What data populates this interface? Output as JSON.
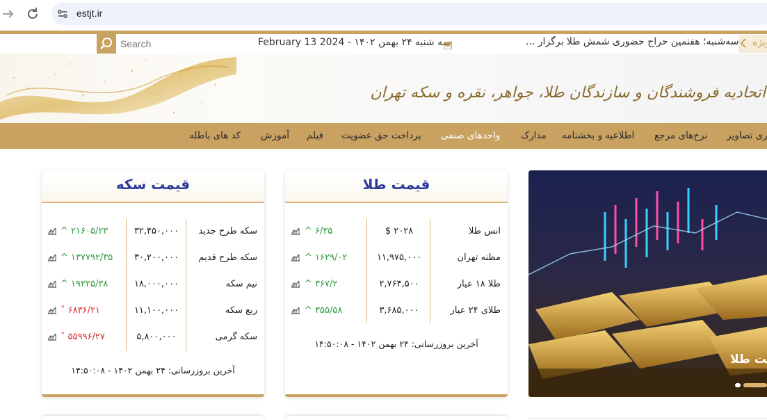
{
  "browser": {
    "back_icon": "arrow-right-icon",
    "reload_icon": "reload-icon",
    "url": "estjt.ir"
  },
  "topbar": {
    "search_placeholder": "Search",
    "date": "سه شنبه ۲۴ بهمن ۱۴۰۲ - February 13 2024",
    "news": "سه‌شنبه؛ هفتمین حراج حضوری شمش طلا برگزار ...",
    "special_label": "ویژه"
  },
  "header": {
    "logo_text": "اتحادیه فروشندگان و سازندگان طلا، جواهر، نقره و سکه تهران"
  },
  "menu": {
    "items": [
      {
        "label": "گالری تصاویر",
        "active": false
      },
      {
        "label": "نرخ‌های مرجع",
        "active": false
      },
      {
        "label": "اطلاعیه و بخشنامه",
        "active": false
      },
      {
        "label": "مدارک",
        "active": false
      },
      {
        "label": "واحدهای صنفی",
        "active": true
      },
      {
        "label": "پرداخت حق عضویت",
        "active": false
      },
      {
        "label": "فیلم",
        "active": false
      },
      {
        "label": "آموزش",
        "active": false
      },
      {
        "label": "کد های باطله",
        "active": false
      }
    ]
  },
  "gold_card": {
    "title": "قیمت طلا",
    "rows": [
      {
        "name": "انس طلا",
        "value": "۲۰۲۸ $",
        "change": "۶/۳۵",
        "direction": "up"
      },
      {
        "name": "مظنه تهران",
        "value": "۱۱,۹۷۵,۰۰۰",
        "change": "۱۶۲۹/۰۲",
        "direction": "up"
      },
      {
        "name": "طلا ۱۸ عیار",
        "value": "۲,۷۶۴,۵۰۰",
        "change": "۳۶۷/۲",
        "direction": "up"
      },
      {
        "name": "طلای ۲۴ عیار",
        "value": "۳,۶۸۵,۰۰۰",
        "change": "۳۵۵/۵۸",
        "direction": "up"
      }
    ],
    "updated": "آخرین بروزرسانی: ۲۴ بهمن ۱۴۰۲ - ۱۴:۵۰:۰۸"
  },
  "coin_card": {
    "title": "قیمت سکه",
    "rows": [
      {
        "name": "سکه طرح جدید",
        "value": "۳۲,۴۵۰,۰۰۰",
        "change": "۲۱۶۰۵/۲۳",
        "direction": "up"
      },
      {
        "name": "سکه طرح قدیم",
        "value": "۳۰,۲۰۰,۰۰۰",
        "change": "۱۳۷۷۹۲/۳۵",
        "direction": "up"
      },
      {
        "name": "نیم سکه",
        "value": "۱۸,۰۰۰,۰۰۰",
        "change": "۱۹۲۲۵/۳۸",
        "direction": "up"
      },
      {
        "name": "ربع سکه",
        "value": "۱۱,۱۰۰,۰۰۰",
        "change": "۶۸۳۶/۲۱",
        "direction": "down"
      },
      {
        "name": "سکه گرمی",
        "value": "۵,۸۰۰,۰۰۰",
        "change": "۵۵۹۹۶/۲۷",
        "direction": "down"
      }
    ],
    "updated": "آخرین بروزرسانی: ۲۴ بهمن ۱۴۰۲ - ۱۴:۵۰:۰۸"
  },
  "slider": {
    "caption": "قیمت طلا"
  },
  "colors": {
    "gold": "#c9a262",
    "title_blue": "#2a3a9c",
    "up": "#2e9c3f",
    "down": "#d32f2f"
  }
}
